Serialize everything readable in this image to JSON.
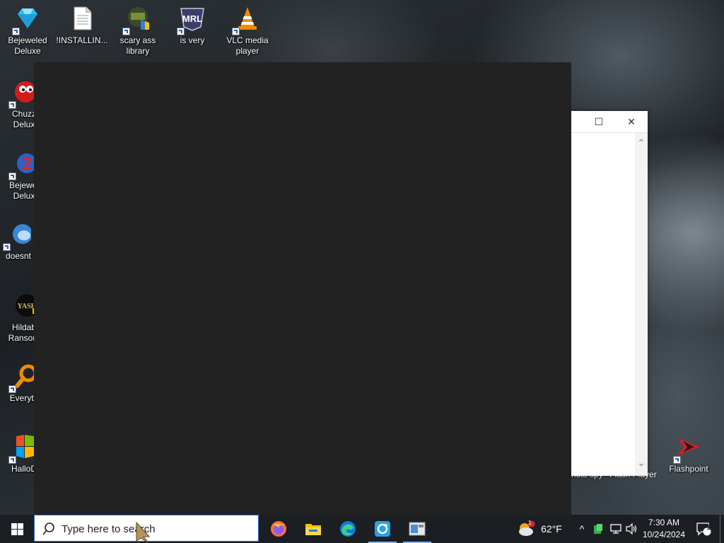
{
  "desktop": {
    "icons_top": [
      {
        "label": "Bejeweled\nDeluxe",
        "icon": "diamond-icon"
      },
      {
        "label": "!INSTALLIN...",
        "icon": "text-file-icon"
      },
      {
        "label": "scary ass\nlibrary",
        "icon": "library-icon"
      },
      {
        "label": "is very",
        "icon": "mrl-logo-icon"
      },
      {
        "label": "VLC media\nplayer",
        "icon": "vlc-cone-icon"
      }
    ],
    "icons_left": [
      {
        "label": "Chuzz\nDelux",
        "icon": "chuzzle-icon"
      },
      {
        "label": "Bejewel\nDelux",
        "icon": "bejeweled2-icon"
      },
      {
        "label": "doesnt",
        "icon": "bird-icon"
      },
      {
        "label": "Hildab\nRansom",
        "icon": "yash-icon",
        "glyph": "YASH"
      },
      {
        "label": "Everyth",
        "icon": "everything-search-icon"
      },
      {
        "label": "HalloD",
        "icon": "windows-shield-icon"
      }
    ],
    "icons_right": [
      {
        "label": "Flashpoint",
        "icon": "flashpoint-icon"
      }
    ],
    "partial_labels": [
      "nuts spy",
      "Flash Player"
    ]
  },
  "background_window": {
    "maximize_glyph": "☐",
    "close_glyph": "✕",
    "scroll_up": "⌃",
    "scroll_down": "⌄"
  },
  "taskbar": {
    "search_placeholder": "Type here to search",
    "weather": {
      "temperature": "62°F",
      "badge": "1"
    },
    "clock": {
      "time": "7:30 AM",
      "date": "10/24/2024"
    },
    "notifications": {
      "count": "1"
    },
    "tray_chevron": "^",
    "apps": [
      "firefox-icon",
      "file-explorer-icon",
      "edge-icon",
      "refresh-app-icon",
      "window-app-icon"
    ]
  },
  "colors": {
    "taskbar": "#1b1e22",
    "dark_window": "#222222",
    "search_border": "#2a6fd6"
  }
}
